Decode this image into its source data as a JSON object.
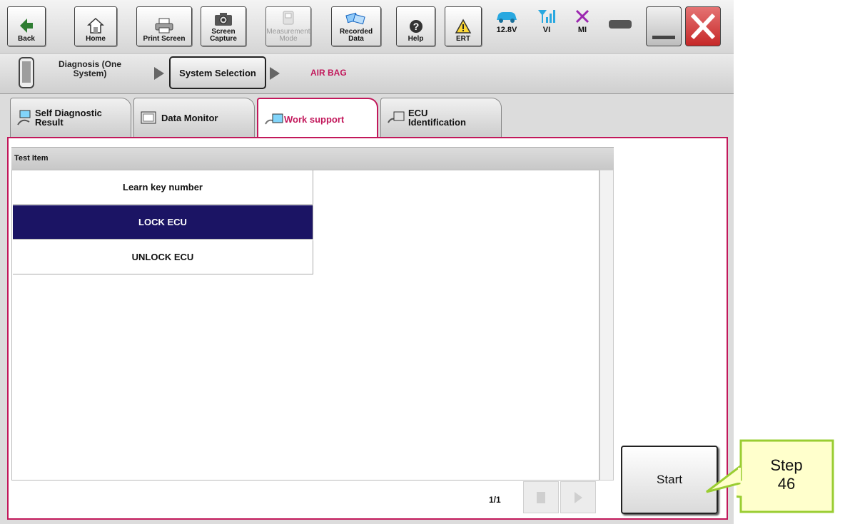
{
  "toolbar": {
    "buttons": [
      {
        "label": "Back",
        "icon": "back-arrow-icon"
      },
      {
        "label": "Home",
        "icon": "home-icon"
      },
      {
        "label": "Print Screen",
        "icon": "printer-icon"
      },
      {
        "label": "Screen\nCapture",
        "icon": "camera-icon"
      },
      {
        "label": "Measurement\nMode",
        "icon": "measurement-icon",
        "enabled": false
      },
      {
        "label": "Recorded\nData",
        "icon": "recorded-data-icon"
      },
      {
        "label": "Help",
        "icon": "help-icon"
      },
      {
        "label": "ERT",
        "icon": "warning-icon"
      }
    ],
    "status": {
      "battery_voltage": "12.8V",
      "vi_label": "VI",
      "mi_label": "MI"
    }
  },
  "breadcrumb": {
    "diagnosis_label": "Diagnosis (One\nSystem)",
    "system_selection_label": "System Selection",
    "current_system": "AIR BAG"
  },
  "tabs": [
    {
      "label": "Self Diagnostic\nResult",
      "icon": "self-diagnostic-icon",
      "active": false
    },
    {
      "label": "Data Monitor",
      "icon": "data-monitor-icon",
      "active": false
    },
    {
      "label": "Work support",
      "icon": "work-support-icon",
      "active": true
    },
    {
      "label": "ECU\nIdentification",
      "icon": "ecu-identification-icon",
      "active": false
    }
  ],
  "test_list": {
    "header": "Test Item",
    "items": [
      {
        "label": "Learn key number",
        "selected": false
      },
      {
        "label": "LOCK ECU",
        "selected": true
      },
      {
        "label": "UNLOCK ECU",
        "selected": false
      }
    ],
    "page_indicator": "1/1"
  },
  "start_button": {
    "label": "Start"
  },
  "callout": {
    "text": "Step\n46"
  },
  "colors": {
    "accent": "#c2185b",
    "selected_row": "#1b1464",
    "close_button": "#d9534f"
  }
}
